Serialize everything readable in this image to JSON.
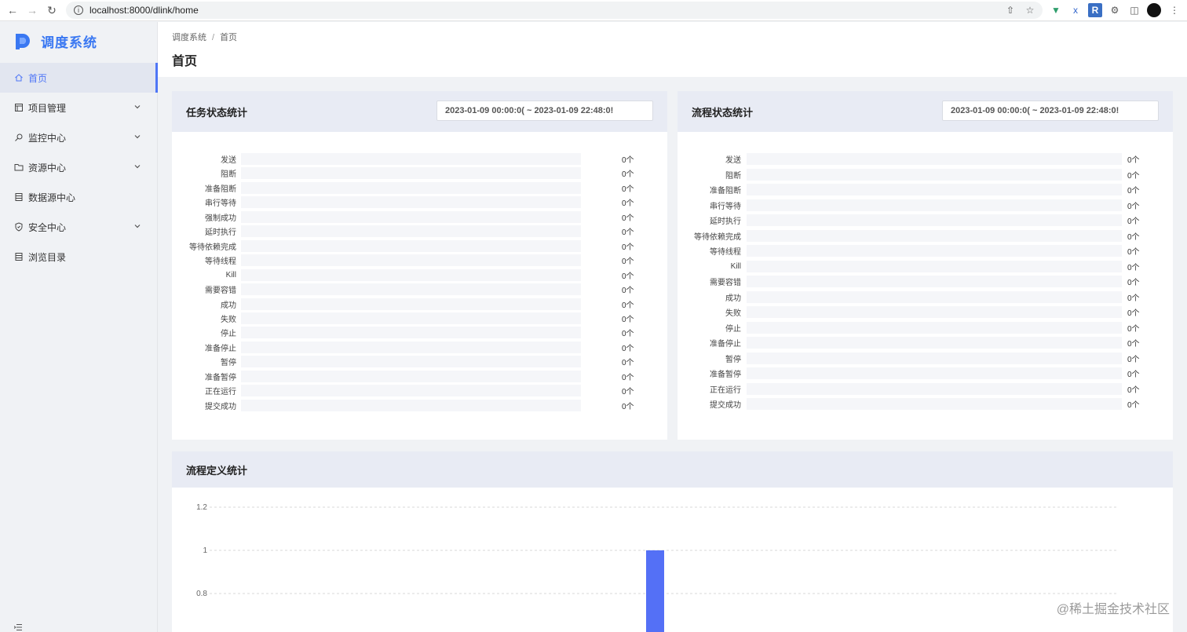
{
  "browser": {
    "url": "localhost:8000/dlink/home"
  },
  "app": {
    "name": "调度系统"
  },
  "sidebar": {
    "items": [
      {
        "label": "首页",
        "icon": "home-icon",
        "active": true,
        "expandable": false
      },
      {
        "label": "项目管理",
        "icon": "project-icon",
        "active": false,
        "expandable": true
      },
      {
        "label": "监控中心",
        "icon": "monitor-icon",
        "active": false,
        "expandable": true
      },
      {
        "label": "资源中心",
        "icon": "folder-icon",
        "active": false,
        "expandable": true
      },
      {
        "label": "数据源中心",
        "icon": "datasource-icon",
        "active": false,
        "expandable": false
      },
      {
        "label": "安全中心",
        "icon": "shield-icon",
        "active": false,
        "expandable": true
      },
      {
        "label": "浏览目录",
        "icon": "catalog-icon",
        "active": false,
        "expandable": false
      }
    ]
  },
  "breadcrumb": {
    "root": "调度系统",
    "separator": "/",
    "current": "首页"
  },
  "page": {
    "title": "首页"
  },
  "task_stats": {
    "title": "任务状态统计",
    "range": "2023-01-09 00:00:0( ~ 2023-01-09 22:48:0!",
    "rows": [
      {
        "label": "发送",
        "count": "0个"
      },
      {
        "label": "阻断",
        "count": "0个"
      },
      {
        "label": "准备阻断",
        "count": "0个"
      },
      {
        "label": "串行等待",
        "count": "0个"
      },
      {
        "label": "强制成功",
        "count": "0个"
      },
      {
        "label": "延时执行",
        "count": "0个"
      },
      {
        "label": "等待依赖完成",
        "count": "0个"
      },
      {
        "label": "等待线程",
        "count": "0个"
      },
      {
        "label": "Kill",
        "count": "0个"
      },
      {
        "label": "需要容错",
        "count": "0个"
      },
      {
        "label": "成功",
        "count": "0个"
      },
      {
        "label": "失败",
        "count": "0个"
      },
      {
        "label": "停止",
        "count": "0个"
      },
      {
        "label": "准备停止",
        "count": "0个"
      },
      {
        "label": "暂停",
        "count": "0个"
      },
      {
        "label": "准备暂停",
        "count": "0个"
      },
      {
        "label": "正在运行",
        "count": "0个"
      },
      {
        "label": "提交成功",
        "count": "0个"
      }
    ]
  },
  "process_stats": {
    "title": "流程状态统计",
    "range": "2023-01-09 00:00:0( ~ 2023-01-09 22:48:0!",
    "rows": [
      {
        "label": "发送",
        "count": "0个"
      },
      {
        "label": "阻断",
        "count": "0个"
      },
      {
        "label": "准备阻断",
        "count": "0个"
      },
      {
        "label": "串行等待",
        "count": "0个"
      },
      {
        "label": "延时执行",
        "count": "0个"
      },
      {
        "label": "等待依赖完成",
        "count": "0个"
      },
      {
        "label": "等待线程",
        "count": "0个"
      },
      {
        "label": "Kill",
        "count": "0个"
      },
      {
        "label": "需要容错",
        "count": "0个"
      },
      {
        "label": "成功",
        "count": "0个"
      },
      {
        "label": "失败",
        "count": "0个"
      },
      {
        "label": "停止",
        "count": "0个"
      },
      {
        "label": "准备停止",
        "count": "0个"
      },
      {
        "label": "暂停",
        "count": "0个"
      },
      {
        "label": "准备暂停",
        "count": "0个"
      },
      {
        "label": "正在运行",
        "count": "0个"
      },
      {
        "label": "提交成功",
        "count": "0个"
      }
    ]
  },
  "definition_stats": {
    "title": "流程定义统计"
  },
  "chart_data": {
    "type": "bar",
    "title": "流程定义统计",
    "categories": [
      ""
    ],
    "values": [
      1
    ],
    "yticks": [
      "1.2",
      "1",
      "0.8"
    ],
    "ylim": [
      0,
      1.2
    ],
    "grid": true,
    "bar_color": "#5470f6"
  },
  "watermark": "@稀土掘金技术社区",
  "colors": {
    "accent": "#4f76f6",
    "card_header": "#e8ebf4"
  }
}
